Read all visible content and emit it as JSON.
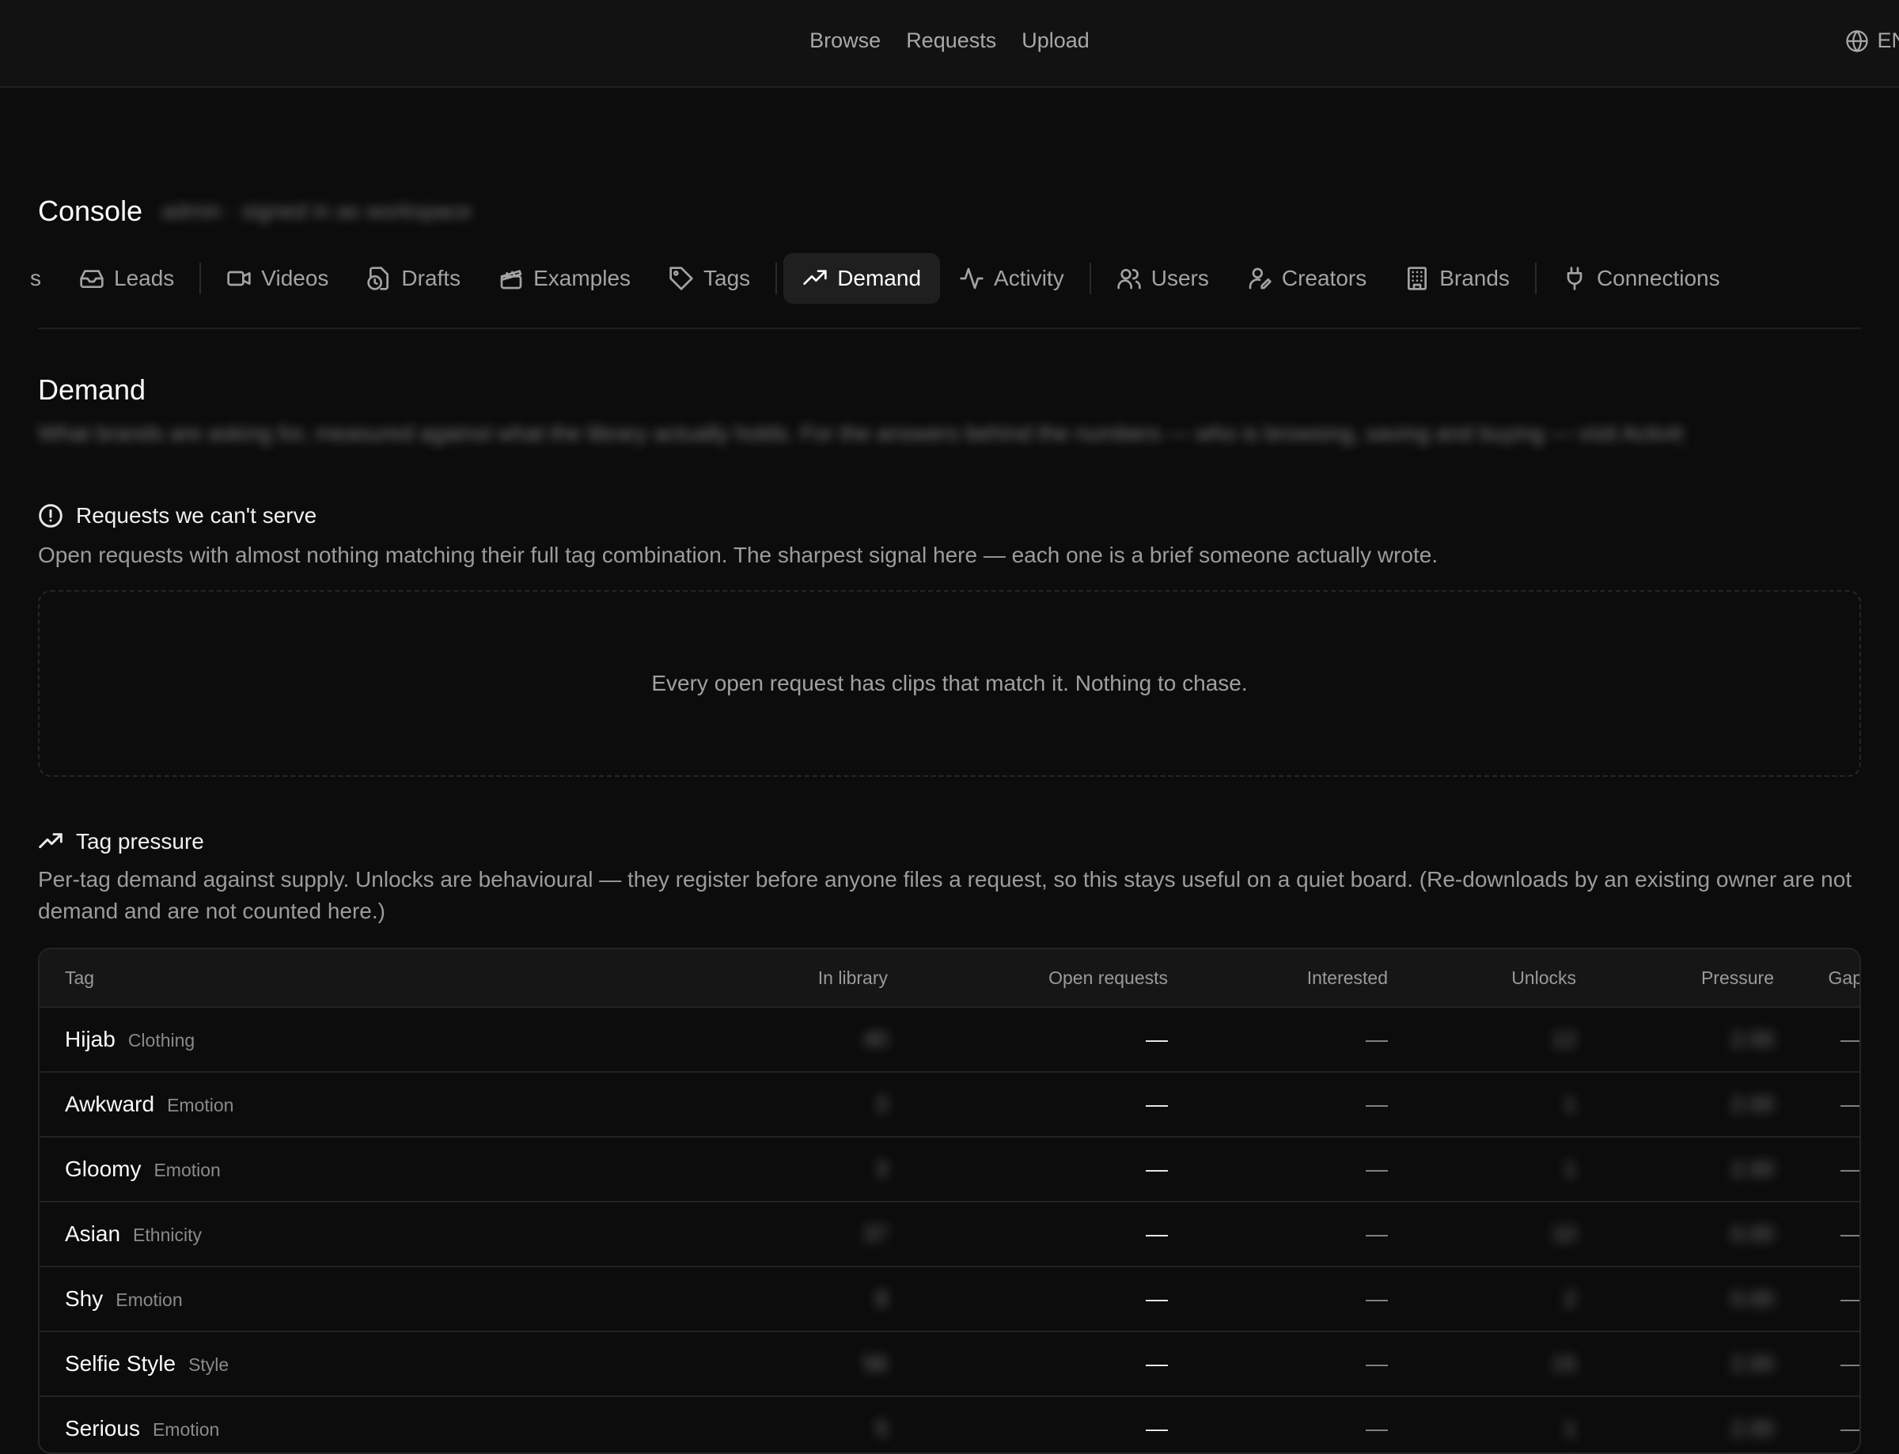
{
  "topnav": {
    "browse": "Browse",
    "requests": "Requests",
    "upload": "Upload",
    "lang": "EN"
  },
  "console": {
    "title": "Console",
    "subtitle_blurred": "admin · signed in as workspace"
  },
  "tabs": {
    "partial": "s",
    "leads": "Leads",
    "videos": "Videos",
    "drafts": "Drafts",
    "examples": "Examples",
    "tags": "Tags",
    "demand": "Demand",
    "activity": "Activity",
    "users": "Users",
    "creators": "Creators",
    "brands": "Brands",
    "connections": "Connections"
  },
  "page": {
    "title": "Demand",
    "description_blurred": "What brands are asking for, measured against what the library actually holds. For the answers behind the numbers — who is browsing, saving and buying — visit Activity."
  },
  "unserved": {
    "title": "Requests we can't serve",
    "description": "Open requests with almost nothing matching their full tag combination. The sharpest signal here — each one is a brief someone actually wrote.",
    "empty": "Every open request has clips that match it. Nothing to chase."
  },
  "pressure": {
    "title": "Tag pressure",
    "description": "Per-tag demand against supply. Unlocks are behavioural — they register before anyone files a request, so this stays useful on a quiet board. (Re-downloads by an existing owner are not demand and are not counted here.)",
    "columns": {
      "tag": "Tag",
      "in_library": "In library",
      "open_requests": "Open requests",
      "interested": "Interested",
      "unlocks": "Unlocks",
      "pressure": "Pressure",
      "gap": "Gap"
    },
    "rows": [
      {
        "tag": "Hijab",
        "category": "Clothing",
        "in_library": "40",
        "open": "—",
        "interested": "—",
        "unlocks": "12",
        "pressure": "2.00",
        "gap": "—"
      },
      {
        "tag": "Awkward",
        "category": "Emotion",
        "in_library": "3",
        "open": "—",
        "interested": "—",
        "unlocks": "1",
        "pressure": "2.00",
        "gap": "—"
      },
      {
        "tag": "Gloomy",
        "category": "Emotion",
        "in_library": "3",
        "open": "—",
        "interested": "—",
        "unlocks": "1",
        "pressure": "2.00",
        "gap": "—"
      },
      {
        "tag": "Asian",
        "category": "Ethnicity",
        "in_library": "37",
        "open": "—",
        "interested": "—",
        "unlocks": "10",
        "pressure": "0.00",
        "gap": "—"
      },
      {
        "tag": "Shy",
        "category": "Emotion",
        "in_library": "8",
        "open": "—",
        "interested": "—",
        "unlocks": "2",
        "pressure": "0.00",
        "gap": "—"
      },
      {
        "tag": "Selfie Style",
        "category": "Style",
        "in_library": "56",
        "open": "—",
        "interested": "—",
        "unlocks": "15",
        "pressure": "2.00",
        "gap": "—"
      },
      {
        "tag": "Serious",
        "category": "Emotion",
        "in_library": "5",
        "open": "—",
        "interested": "—",
        "unlocks": "1",
        "pressure": "2.00",
        "gap": "—"
      }
    ]
  }
}
